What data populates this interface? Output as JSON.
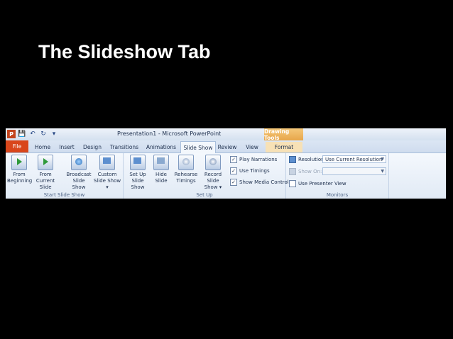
{
  "slide": {
    "title": "The Slideshow Tab"
  },
  "titlebar": {
    "window_title": "Presentation1 - Microsoft PowerPoint",
    "contextual_tab": "Drawing Tools",
    "qat": {
      "app": "P",
      "save": "💾",
      "undo": "↶",
      "redo": "↻",
      "customize": "▾"
    }
  },
  "tabs": [
    "File",
    "Home",
    "Insert",
    "Design",
    "Transitions",
    "Animations",
    "Slide Show",
    "Review",
    "View",
    "Format"
  ],
  "active_tab": "Slide Show",
  "groups": {
    "start": {
      "label": "Start Slide Show",
      "from_beginning": [
        "From",
        "Beginning"
      ],
      "from_current": [
        "From",
        "Current Slide"
      ],
      "broadcast": [
        "Broadcast",
        "Slide Show"
      ],
      "custom": [
        "Custom",
        "Slide Show ▾"
      ]
    },
    "setup": {
      "label": "Set Up",
      "setup_show": [
        "Set Up",
        "Slide Show"
      ],
      "hide_slide": [
        "Hide",
        "Slide"
      ],
      "rehearse": [
        "Rehearse",
        "Timings"
      ],
      "record": [
        "Record Slide",
        "Show ▾"
      ],
      "play_narrations": "Play Narrations",
      "use_timings": "Use Timings",
      "show_media_controls": "Show Media Controls"
    },
    "monitors": {
      "label": "Monitors",
      "resolution_label": "Resolution:",
      "resolution_value": "Use Current Resolution",
      "show_on_label": "Show On:",
      "show_on_value": "",
      "presenter_view": "Use Presenter View"
    }
  },
  "colors": {
    "file_tab": "#d9461b",
    "contextual": "#e7a64a",
    "ribbon_bg": "#e1eaf5"
  }
}
